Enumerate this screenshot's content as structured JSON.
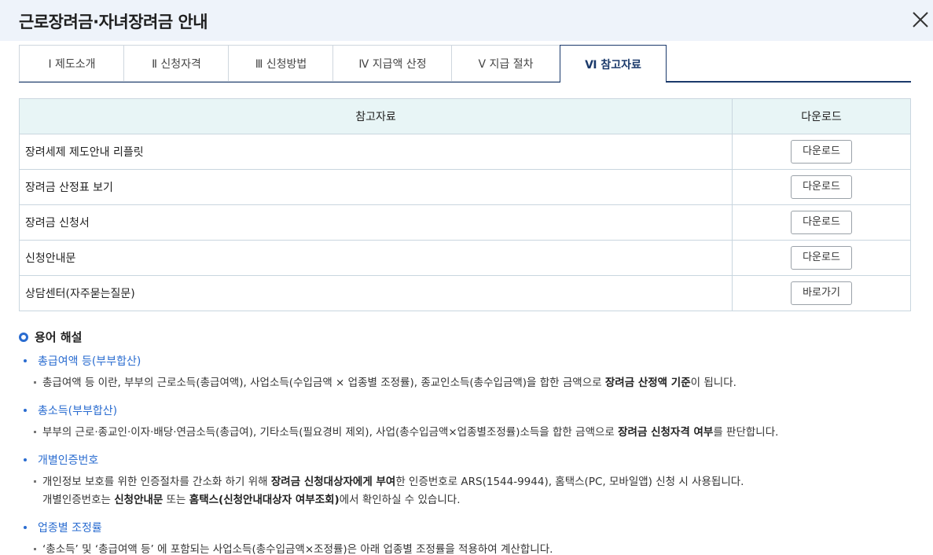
{
  "header": {
    "title": "근로장려금·자녀장려금 안내"
  },
  "tabs": [
    {
      "label": "Ⅰ  제도소개"
    },
    {
      "label": "Ⅱ  신청자격"
    },
    {
      "label": "Ⅲ  신청방법"
    },
    {
      "label": "Ⅳ  지급액 산정"
    },
    {
      "label": "Ⅴ  지급 절차"
    },
    {
      "label": "Ⅵ  참고자료",
      "active": true
    }
  ],
  "table": {
    "headers": [
      "참고자료",
      "다운로드"
    ],
    "rows": [
      {
        "name": "장려세제 제도안내 리플릿",
        "action": "다운로드"
      },
      {
        "name": "장려금 산정표 보기",
        "action": "다운로드"
      },
      {
        "name": "장려금 신청서",
        "action": "다운로드"
      },
      {
        "name": "신청안내문",
        "action": "다운로드"
      },
      {
        "name": "상담센터(자주묻는질문)",
        "action": "바로가기"
      }
    ]
  },
  "terms": {
    "heading": "용어 해설",
    "items": [
      {
        "name": "총급여액 등(부부합산)",
        "desc1_a": "총급여액 등 이란, 부부의 근로소득(총급여액), 사업소득(수입금액 × 업종별 조정률), 종교인소득(총수입금액)을 합한 금액으로 ",
        "desc1_b": "장려금 산정액 기준",
        "desc1_c": "이 됩니다."
      },
      {
        "name": "총소득(부부합산)",
        "desc1_a": "부부의 근로·종교인·이자·배당·연금소득(총급여), 기타소득(필요경비 제외), 사업(총수입금액×업종별조정률)소득을 합한 금액으로 ",
        "desc1_b": "장려금 신청자격 여부",
        "desc1_c": "를 판단합니다."
      },
      {
        "name": "개별인증번호",
        "desc1_a": "개인정보 보호를 위한 인증절차를 간소화 하기 위해 ",
        "desc1_b": "장려금 신청대상자에게 부여",
        "desc1_c": "한 인증번호로 ARS(1544-9944), 홈택스(PC, 모바일앱) 신청 시 사용됩니다.",
        "desc2_a": "개별인증번호는 ",
        "desc2_b": "신청안내문",
        "desc2_c": " 또는 ",
        "desc2_d": "홈택스(신청안내대상자 여부조회)",
        "desc2_e": "에서 확인하실 수 있습니다."
      },
      {
        "name": "업종별 조정률",
        "desc1_a": "‘총소득’ 및 ‘총급여액 등’ 에 포함되는 사업소득(총수입금액×조정률)은 아래 업종별 조정률을 적용하여 계산합니다."
      }
    ]
  },
  "colors": {
    "accent": "#2a6cd0",
    "tab_active": "#1b3a6b",
    "table_header_bg": "#e8f5f6",
    "header_bg": "#eef3fa"
  },
  "icons": {
    "close": "close-icon"
  }
}
